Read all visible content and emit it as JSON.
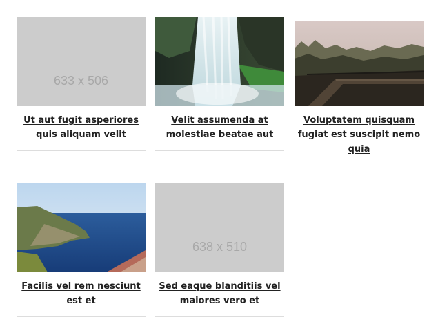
{
  "posts": [
    {
      "image": "placeholder",
      "placeholder_text": "633 x 506",
      "title": "Ut aut fugit asperiores quis aliquam velit"
    },
    {
      "image": "waterfall-photo",
      "title": "Velit assumenda at molestiae beatae aut"
    },
    {
      "image": "misty-forest-boardwalk-photo",
      "title": "Voluptatem quisquam fugiat est suscipit nemo quia"
    },
    {
      "image": "coastal-cliffs-sea-photo",
      "title": "Facilis vel rem nesciunt est et"
    },
    {
      "image": "placeholder",
      "placeholder_text": "638 x 510",
      "title": "Sed eaque blanditiis vel maiores vero et"
    }
  ],
  "colors": {
    "placeholder_bg": "#cccccc",
    "placeholder_text": "#a8a8a8",
    "title": "#222222",
    "rule": "#dddddd"
  }
}
